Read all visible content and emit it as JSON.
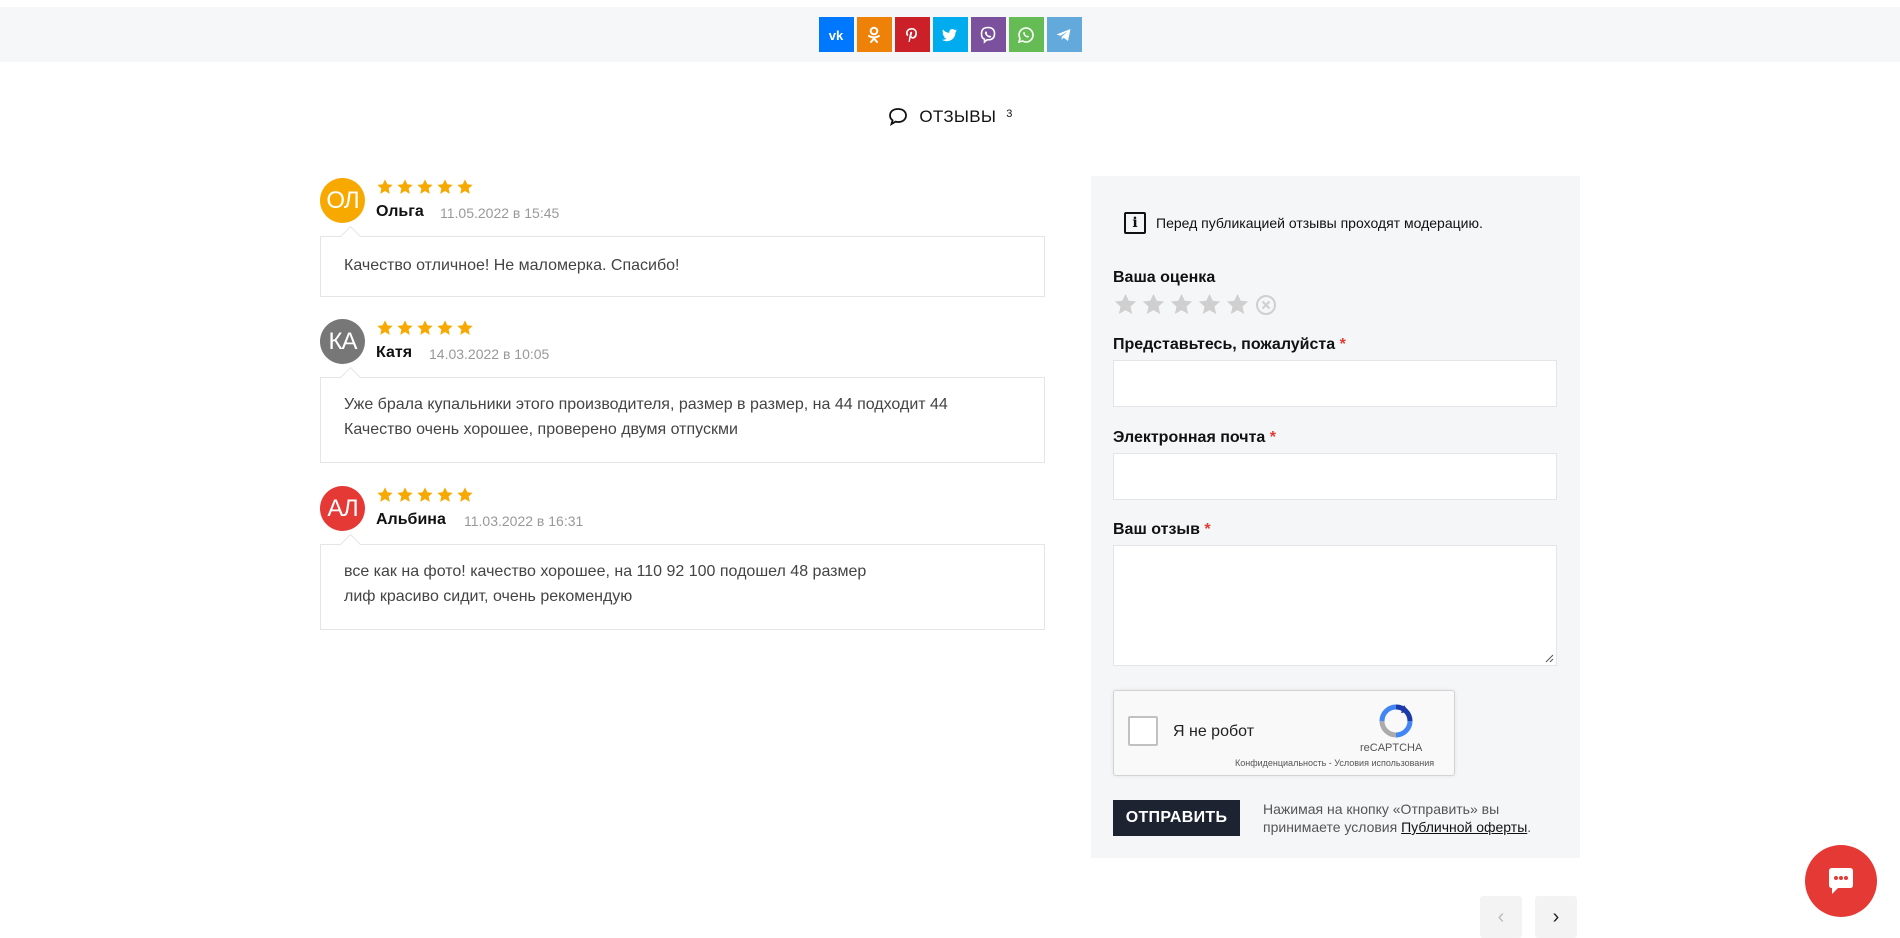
{
  "share": [
    {
      "name": "vk",
      "label": "vk",
      "color": "#0077ff"
    },
    {
      "name": "odnoklassniki",
      "label": "ok",
      "color": "#ee8208"
    },
    {
      "name": "pinterest",
      "label": "P",
      "color": "#cb2027"
    },
    {
      "name": "twitter",
      "label": "t",
      "color": "#00aced"
    },
    {
      "name": "viber",
      "label": "v",
      "color": "#7b519d"
    },
    {
      "name": "whatsapp",
      "label": "w",
      "color": "#65bc54"
    },
    {
      "name": "telegram",
      "label": "tg",
      "color": "#64a9dc"
    }
  ],
  "reviews_section": {
    "title": "ОТЗЫВЫ",
    "count": "3"
  },
  "reviews": [
    {
      "initials": "ОЛ",
      "avatar_color": "#f7a900",
      "rating": 5,
      "name": "Ольга",
      "date": "11.05.2022 в 15:45",
      "text_lines": [
        "Качество отличное! Не маломерка. Спасибо!"
      ]
    },
    {
      "initials": "КА",
      "avatar_color": "#777777",
      "rating": 5,
      "name": "Катя",
      "date": "14.03.2022 в 10:05",
      "text_lines": [
        "Уже брала купальники этого производителя, размер в размер, на 44 подходит 44",
        "Качество очень хорошее, проверено двумя отпускми"
      ]
    },
    {
      "initials": "АЛ",
      "avatar_color": "#e53935",
      "rating": 5,
      "name": "Альбина",
      "date": "11.03.2022 в 16:31",
      "text_lines": [
        "все как на фото! качество хорошее, на 110 92 100 подошел 48 размер",
        "лиф красиво сидит, очень рекомендую"
      ]
    }
  ],
  "form": {
    "notice": "Перед публикацией отзывы проходят модерацию.",
    "rating_label": "Ваша оценка",
    "rating_value": 0,
    "rating_max": 5,
    "name_label": "Представьтесь, пожалуйста",
    "email_label": "Электронная почта",
    "review_label": "Ваш отзыв",
    "required_mark": "*",
    "captcha_text": "Я не робот",
    "captcha_brand": "reCAPTCHA",
    "captcha_links": "Конфиденциальность - Условия использования",
    "submit_label": "ОТПРАВИТЬ",
    "terms_prefix": "Нажимая на кнопку «Отправить» вы принимаете условия ",
    "terms_link": "Публичной оферты",
    "terms_suffix": "."
  },
  "colors": {
    "star_active": "#f7a900",
    "star_inactive": "#cfcfcf",
    "chat": "#e53935"
  }
}
